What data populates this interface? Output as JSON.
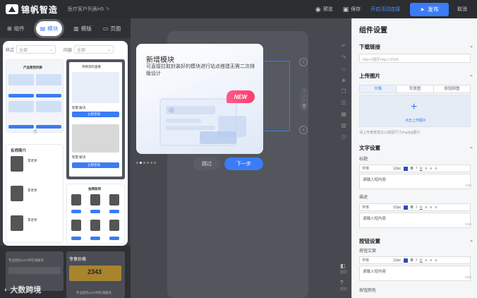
{
  "topbar": {
    "logo_text": "锦帆智造",
    "project_name": "医疗客户列表H5",
    "preview_label": "预览",
    "save_label": "保存",
    "activity_link": "开启活动连接",
    "publish_label": "发布",
    "cancel_label": "取消"
  },
  "left_tabs": [
    {
      "label": "组件"
    },
    {
      "label": "模块"
    },
    {
      "label": "模版"
    },
    {
      "label": "页面"
    }
  ],
  "filter": {
    "style_label": "样式",
    "style_value": "全部",
    "content_label": "内容",
    "content_value": "全部"
  },
  "modules": {
    "card1_title": "产品使用列表",
    "card2_title": "项目资料查看",
    "card2_btn1": "立即咨询",
    "card2_btn2": "立即咨询",
    "card2_name1": "智慧 解决",
    "card2_name2": "智慧 解决",
    "card3_title": "名师简介",
    "card3_names": [
      "李老师",
      "李老师",
      "李老师"
    ],
    "card4_title": "金牌医师",
    "card5_title": "专业团队24小时在线服务",
    "card6_title": "专享价格",
    "card6_price": "2343",
    "card6_sub": "专业团队24小时在线服务"
  },
  "popup": {
    "title": "新增模块",
    "desc": "可直接拉取封装好的模块进行站点搭建无需二次排版设计",
    "badge": "NEW",
    "skip_label": "跳过",
    "next_label": "下一步"
  },
  "right_panel": {
    "title": "组件设置",
    "download_section": "下载链接",
    "download_placeholder": "http://插件http://.PH5",
    "upload_section": "上传图片",
    "upload_tabs": [
      "头像",
      "背景图",
      "按钮颜图"
    ],
    "upload_text": "点击上传图片",
    "upload_hint": "请上传宽度建议以底图尺寸png/jpg图片",
    "text_section": "文字设置",
    "title_label": "标题",
    "font_label": "字体",
    "size_label": "12px",
    "placeholder_text": "请输入短内容",
    "count1": "0/20",
    "desc_label": "描述",
    "font_label2": "字体",
    "size_label2": "12px",
    "placeholder_text2": "请输入短内容",
    "count2": "0/20",
    "button_section": "按钮设置",
    "button_text_label": "按钮文案",
    "font_label3": "字体",
    "size_label3": "12px",
    "placeholder_text3": "请输入短内容",
    "count3": "0/20",
    "button_color_label": "按钮颜色"
  },
  "side_labels": {
    "layer": "图层",
    "help": "帮助"
  },
  "watermark": "大数跨境"
}
